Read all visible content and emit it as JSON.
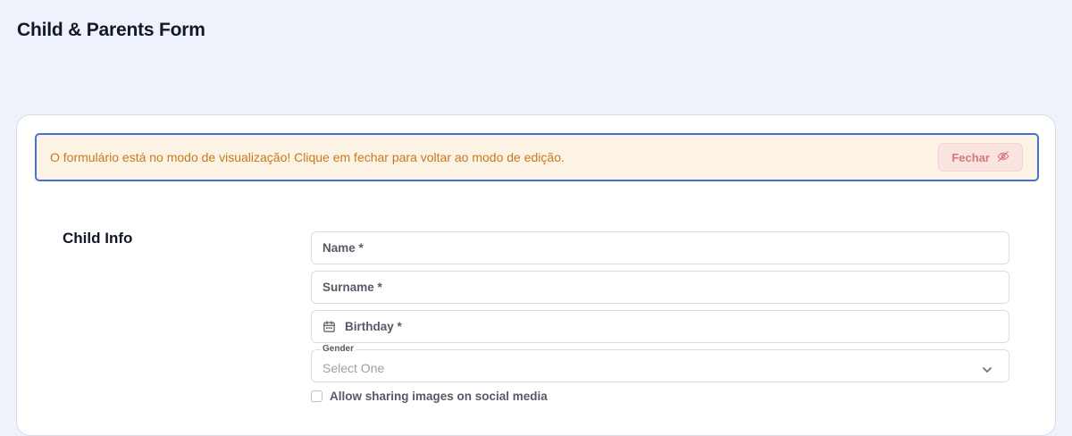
{
  "page": {
    "title": "Child & Parents Form"
  },
  "alert": {
    "message": "O formulário está no modo de visualização! Clique em fechar para voltar ao modo de edição.",
    "close_label": "Fechar",
    "close_icon": "eye-off-icon"
  },
  "section": {
    "title": "Child Info"
  },
  "fields": {
    "name": {
      "label": "Name *"
    },
    "surname": {
      "label": "Surname *"
    },
    "birthday": {
      "label": "Birthday *",
      "icon": "calendar-icon"
    },
    "gender": {
      "label": "Gender",
      "value": "Select One",
      "icon": "chevron-down-icon"
    },
    "share_images": {
      "label": "Allow sharing images on social media",
      "checked": false
    }
  },
  "colors": {
    "background": "#eef2fb",
    "alert_bg": "#fdf3e4",
    "alert_border": "#4a6fd8",
    "alert_text": "#c67a1c",
    "close_button_bg": "#fbe3e1",
    "close_button_text": "#d27a7a"
  }
}
